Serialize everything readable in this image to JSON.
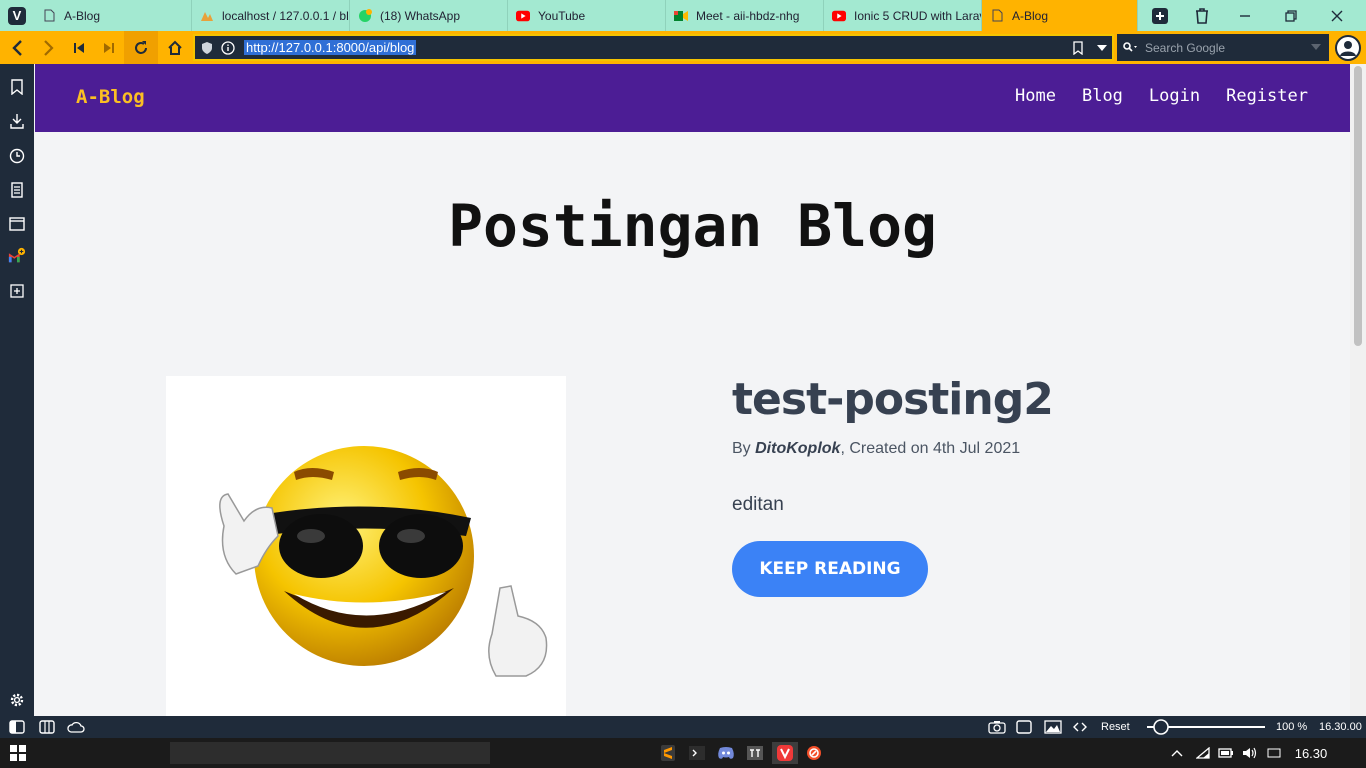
{
  "browser": {
    "tabs": [
      {
        "title": "A-Blog",
        "icon": "page-icon"
      },
      {
        "title": "localhost / 127.0.0.1 / bl",
        "icon": "phpmyadmin-icon"
      },
      {
        "title": "(18) WhatsApp",
        "icon": "whatsapp-icon"
      },
      {
        "title": "YouTube",
        "icon": "youtube-icon"
      },
      {
        "title": "Meet - aii-hbdz-nhg",
        "icon": "meet-icon"
      },
      {
        "title": "Ionic 5 CRUD with Larav",
        "icon": "youtube-icon"
      },
      {
        "title": "A-Blog",
        "icon": "page-icon",
        "active": true
      }
    ],
    "url": "http://127.0.0.1:8000/api/blog",
    "search_placeholder": "Search Google",
    "accent": "#ffb300",
    "tabbar_color": "#a3e9d1"
  },
  "site": {
    "brand": "A-Blog",
    "nav": [
      "Home",
      "Blog",
      "Login",
      "Register"
    ],
    "page_title": "Postingan Blog",
    "post": {
      "title": "test-posting2",
      "by": "By ",
      "author": "DitoKoplok",
      "created": ", Created on 4th Jul 2021",
      "excerpt": "editan",
      "button": "KEEP READING"
    }
  },
  "statusbar": {
    "reset": "Reset",
    "zoom": "100 %",
    "time": "16.30.00"
  },
  "taskbar": {
    "clock": "16.30"
  }
}
